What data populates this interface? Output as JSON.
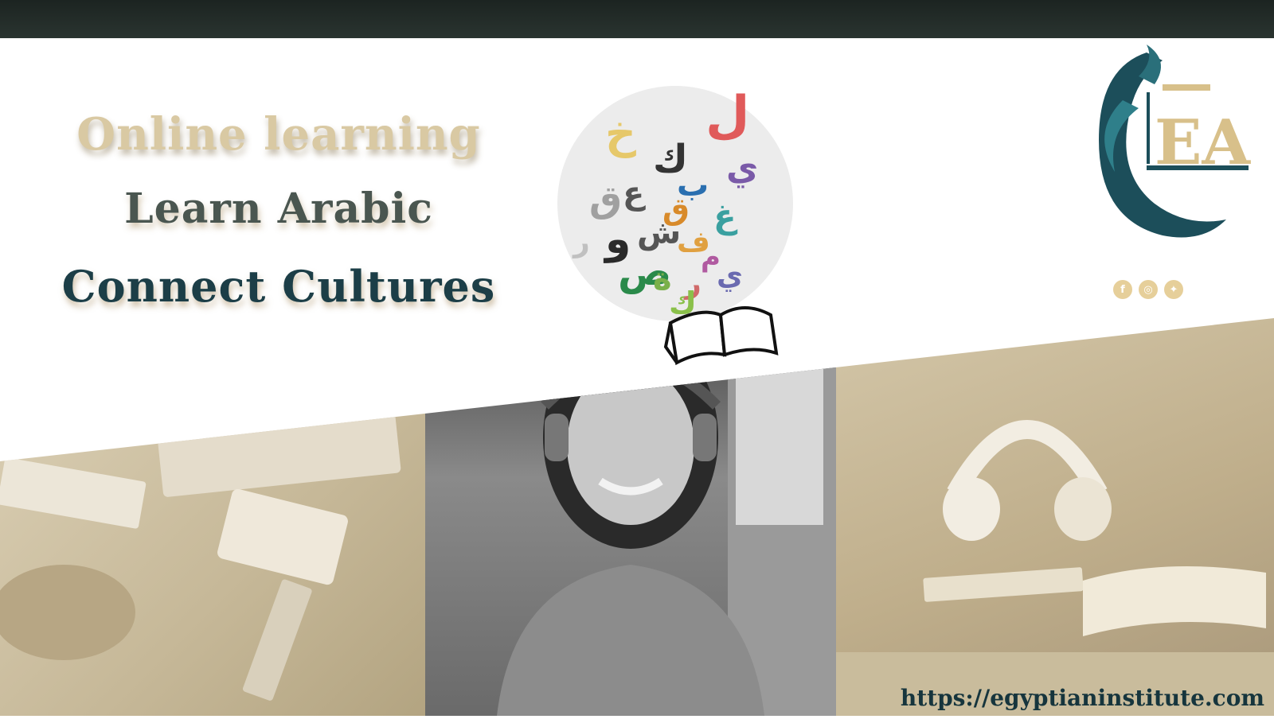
{
  "headlines": {
    "line1": "Online learning",
    "line2": "Learn Arabic",
    "line3": "Connect Cultures"
  },
  "website": {
    "url": "https://egyptianinstitute.com"
  },
  "logo": {
    "letters": "EA"
  },
  "social_icons": [
    "facebook-icon",
    "instagram-icon",
    "twitter-icon"
  ],
  "colors": {
    "top_bar": "#1c2421",
    "headline_1": "#d9c9a3",
    "headline_2": "#4a5650",
    "headline_3": "#1c3e47",
    "brand_teal": "#1c4e5a",
    "brand_gold": "#d8c08a"
  }
}
